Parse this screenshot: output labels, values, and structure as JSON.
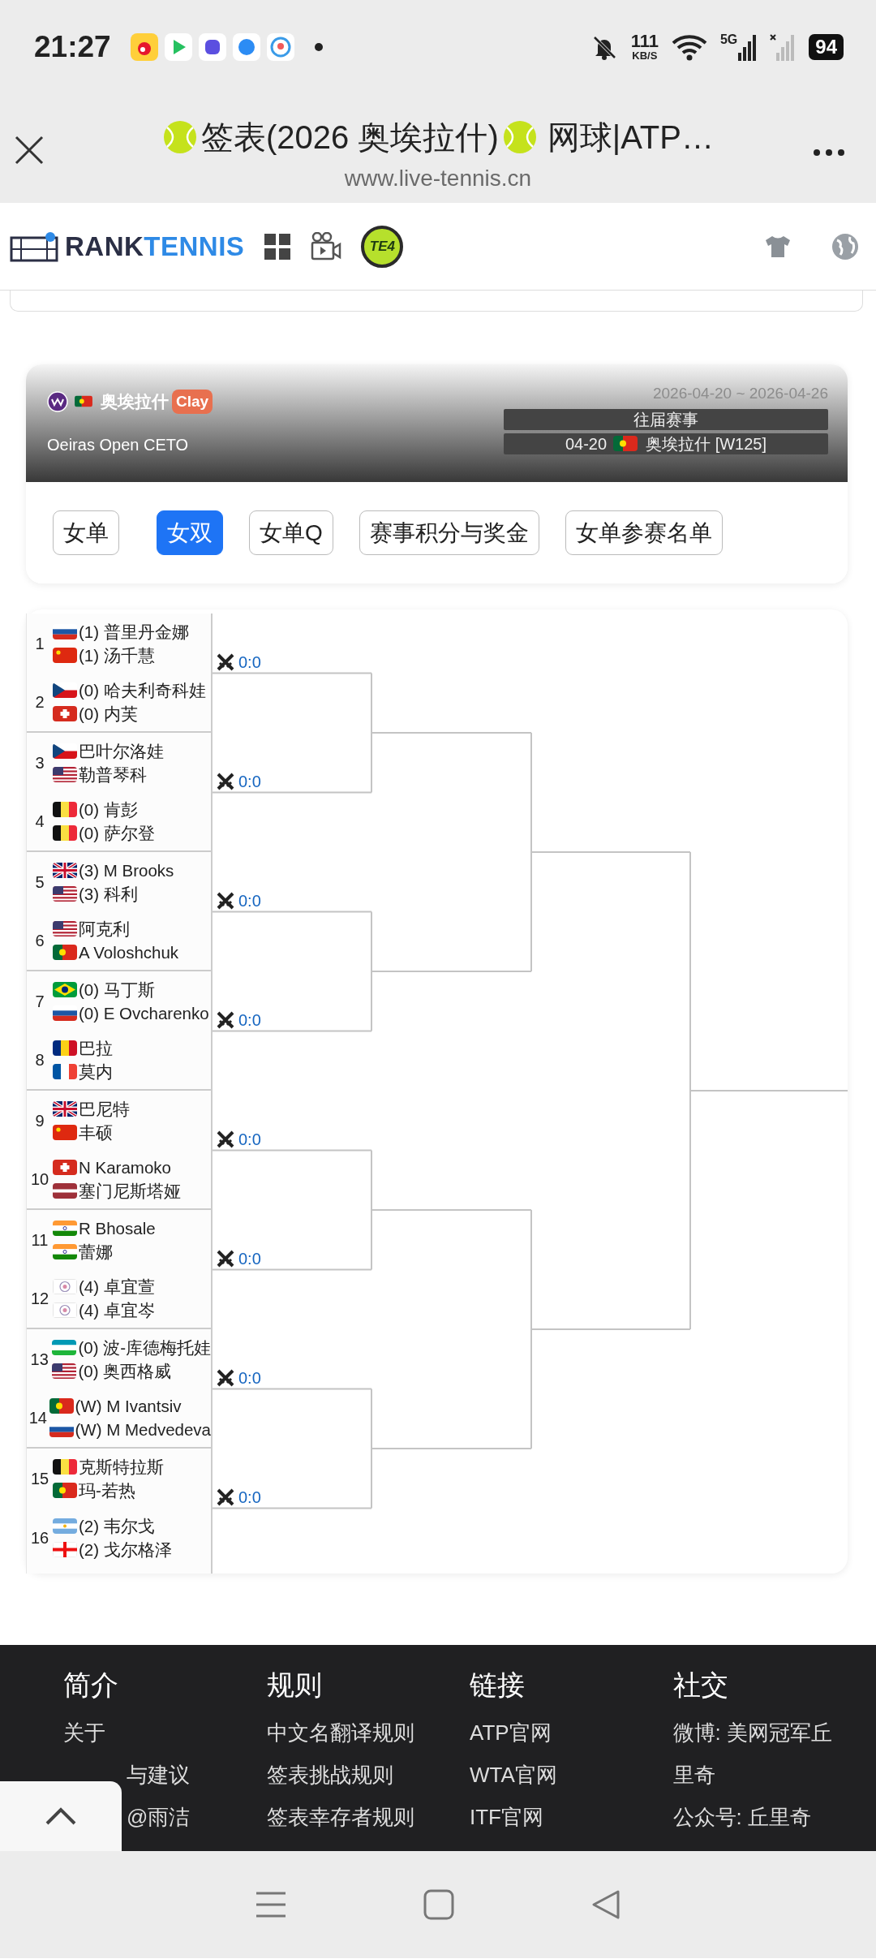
{
  "status_bar": {
    "time": "21:27",
    "net_speed": "111",
    "net_unit": "KB/S",
    "network": "5G",
    "battery": "94"
  },
  "browser": {
    "title_before": "签表(2026 奥埃拉什)",
    "title_after": "网球|ATP…",
    "url": "www.live-tennis.cn"
  },
  "navbar": {
    "brand_dark": "RANK",
    "brand_accent": "TENNIS",
    "badge": "TE4"
  },
  "tournament": {
    "name": "奥埃拉什",
    "flag": {
      "kind": "pt"
    },
    "surface": "Clay",
    "subtitle": "Oeiras Open CETO",
    "dates": "2026-04-20 ~ 2026-04-26",
    "history_label": "往届赛事",
    "past_events": [
      {
        "date": "04-20",
        "flag": {
          "kind": "pt"
        },
        "name": "奥埃拉什 [W125]"
      }
    ]
  },
  "tabs": [
    {
      "label": "女单",
      "selected": false
    },
    {
      "label": "女双",
      "selected": true
    },
    {
      "label": "女单Q",
      "selected": false
    },
    {
      "label": "赛事积分与奖金",
      "selected": false
    },
    {
      "label": "女单参赛名单",
      "selected": false
    }
  ],
  "draw": {
    "entries": [
      {
        "number": "1",
        "players": [
          {
            "flag": {
              "kind": "ru"
            },
            "name": "(1) 普里丹金娜"
          },
          {
            "flag": {
              "kind": "cn"
            },
            "name": "(1) 汤千慧"
          }
        ]
      },
      {
        "number": "2",
        "players": [
          {
            "flag": {
              "kind": "cz"
            },
            "name": "(0) 哈夫利奇科娃"
          },
          {
            "flag": {
              "kind": "ch"
            },
            "name": "(0) 内芙"
          }
        ]
      },
      {
        "number": "3",
        "players": [
          {
            "flag": {
              "kind": "cz"
            },
            "name": "巴叶尔洛娃"
          },
          {
            "flag": {
              "kind": "us"
            },
            "name": "勒普琴科"
          }
        ]
      },
      {
        "number": "4",
        "players": [
          {
            "flag": {
              "kind": "be"
            },
            "name": "(0) 肯彭"
          },
          {
            "flag": {
              "kind": "be"
            },
            "name": "(0) 萨尔登"
          }
        ]
      },
      {
        "number": "5",
        "players": [
          {
            "flag": {
              "kind": "gb"
            },
            "name": "(3) M Brooks"
          },
          {
            "flag": {
              "kind": "us"
            },
            "name": "(3) 科利"
          }
        ]
      },
      {
        "number": "6",
        "players": [
          {
            "flag": {
              "kind": "us"
            },
            "name": "阿克利"
          },
          {
            "flag": {
              "kind": "pt"
            },
            "name": "A Voloshchuk"
          }
        ]
      },
      {
        "number": "7",
        "players": [
          {
            "flag": {
              "kind": "br"
            },
            "name": "(0) 马丁斯"
          },
          {
            "flag": {
              "kind": "ru"
            },
            "name": "(0) E Ovcharenko"
          }
        ]
      },
      {
        "number": "8",
        "players": [
          {
            "flag": {
              "kind": "ro"
            },
            "name": "巴拉"
          },
          {
            "flag": {
              "kind": "fr"
            },
            "name": "莫内"
          }
        ]
      },
      {
        "number": "9",
        "players": [
          {
            "flag": {
              "kind": "gb"
            },
            "name": "巴尼特"
          },
          {
            "flag": {
              "kind": "cn"
            },
            "name": "丰硕"
          }
        ]
      },
      {
        "number": "10",
        "players": [
          {
            "flag": {
              "kind": "ch"
            },
            "name": "N Karamoko"
          },
          {
            "flag": {
              "kind": "lv"
            },
            "name": "塞门尼斯塔娅"
          }
        ]
      },
      {
        "number": "11",
        "players": [
          {
            "flag": {
              "kind": "in"
            },
            "name": "R Bhosale"
          },
          {
            "flag": {
              "kind": "in"
            },
            "name": "蕾娜"
          }
        ]
      },
      {
        "number": "12",
        "players": [
          {
            "flag": {
              "kind": "tpe"
            },
            "name": "(4) 卓宜萱"
          },
          {
            "flag": {
              "kind": "tpe"
            },
            "name": "(4) 卓宜岑"
          }
        ]
      },
      {
        "number": "13",
        "players": [
          {
            "flag": {
              "kind": "uz"
            },
            "name": "(0) 波-库德梅托娃"
          },
          {
            "flag": {
              "kind": "us"
            },
            "name": "(0) 奥西格威"
          }
        ]
      },
      {
        "number": "14",
        "players": [
          {
            "flag": {
              "kind": "pt"
            },
            "name": "(W) M Ivantsiv"
          },
          {
            "flag": {
              "kind": "ru"
            },
            "name": "(W) M Medvedeva"
          }
        ]
      },
      {
        "number": "15",
        "players": [
          {
            "flag": {
              "kind": "be"
            },
            "name": "克斯特拉斯"
          },
          {
            "flag": {
              "kind": "pt"
            },
            "name": "玛-若热"
          }
        ]
      },
      {
        "number": "16",
        "players": [
          {
            "flag": {
              "kind": "ar"
            },
            "name": "(2) 韦尔戈"
          },
          {
            "flag": {
              "kind": "ge"
            },
            "name": "(2) 戈尔格泽"
          }
        ]
      }
    ],
    "matches": [
      {
        "score": "0:0"
      },
      {
        "score": "0:0"
      },
      {
        "score": "0:0"
      },
      {
        "score": "0:0"
      },
      {
        "score": "0:0"
      },
      {
        "score": "0:0"
      },
      {
        "score": "0:0"
      },
      {
        "score": "0:0"
      }
    ]
  },
  "footer": [
    {
      "heading": "简介",
      "links": [
        {
          "text": "关于",
          "kind": "plain"
        },
        {
          "text": "与建议",
          "kind": "clipped"
        },
        {
          "text": "@雨洁",
          "kind": "clipped"
        }
      ]
    },
    {
      "heading": "规则",
      "links": [
        {
          "text": "中文名翻译规则",
          "kind": "plain"
        },
        {
          "text": "签表挑战规则",
          "kind": "plain"
        },
        {
          "text": "签表幸存者规则",
          "kind": "plain"
        }
      ]
    },
    {
      "heading": "链接",
      "links": [
        {
          "text": "ATP官网",
          "kind": "plain"
        },
        {
          "text": "WTA官网",
          "kind": "plain"
        },
        {
          "text": "ITF官网",
          "kind": "plain"
        }
      ]
    },
    {
      "heading": "社交",
      "links": [
        {
          "text": "微博: 美网冠军丘",
          "kind": "plain"
        },
        {
          "text": "里奇",
          "kind": "plain"
        },
        {
          "text": "公众号: 丘里奇",
          "kind": "plain"
        }
      ]
    }
  ]
}
